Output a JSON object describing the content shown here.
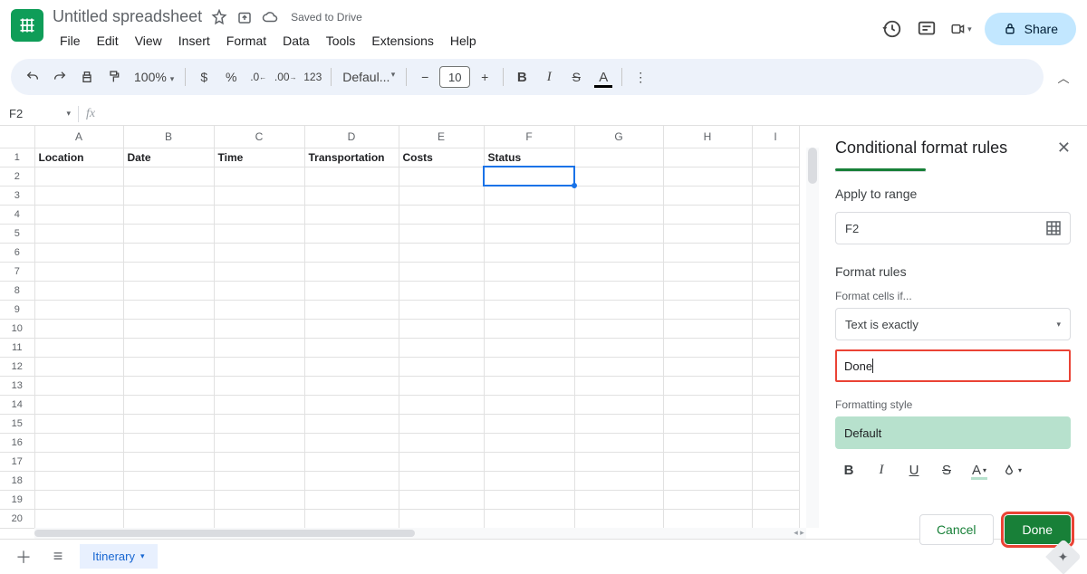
{
  "doc": {
    "title": "Untitled spreadsheet",
    "save_status": "Saved to Drive"
  },
  "menu": {
    "file": "File",
    "edit": "Edit",
    "view": "View",
    "insert": "Insert",
    "format": "Format",
    "data": "Data",
    "tools": "Tools",
    "extensions": "Extensions",
    "help": "Help"
  },
  "share": {
    "label": "Share"
  },
  "toolbar": {
    "zoom": "100%",
    "currency": "$",
    "percent": "%",
    "dec_dec": ".0",
    "inc_dec": ".00",
    "num123": "123",
    "font": "Defaul...",
    "minus": "−",
    "font_size": "10",
    "plus": "+",
    "bold": "B",
    "italic": "I",
    "strike": "S",
    "textcolor": "A"
  },
  "namebox": {
    "cell": "F2",
    "fx": "fx"
  },
  "columns": {
    "A": "A",
    "B": "B",
    "C": "C",
    "D": "D",
    "E": "E",
    "F": "F",
    "G": "G",
    "H": "H",
    "I": "I"
  },
  "headers": {
    "A": "Location",
    "B": "Date",
    "C": "Time",
    "D": "Transportation",
    "E": "Costs",
    "F": "Status"
  },
  "rows_label": {
    "r1": "1",
    "r2": "2",
    "r3": "3",
    "r4": "4",
    "r5": "5",
    "r6": "6",
    "r7": "7",
    "r8": "8",
    "r9": "9",
    "r10": "10",
    "r11": "11",
    "r12": "12",
    "r13": "13",
    "r14": "14",
    "r15": "15",
    "r16": "16",
    "r17": "17",
    "r18": "18",
    "r19": "19",
    "r20": "20"
  },
  "panel": {
    "title": "Conditional format rules",
    "apply_label": "Apply to range",
    "range_value": "F2",
    "rules_label": "Format rules",
    "cells_if_label": "Format cells if...",
    "condition": "Text is exactly",
    "value": "Done",
    "style_label": "Formatting style",
    "style_preview": "Default",
    "style_toolbar": {
      "b": "B",
      "i": "I",
      "u": "U",
      "s": "S",
      "tc": "A"
    },
    "cancel": "Cancel",
    "done": "Done"
  },
  "sheet_tab": {
    "name": "Itinerary"
  }
}
